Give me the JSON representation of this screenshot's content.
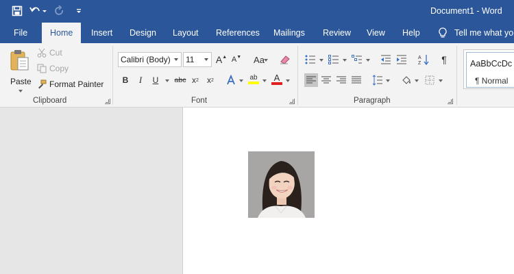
{
  "window": {
    "title": "Document1 - Word"
  },
  "quick_access": {
    "icons": [
      "save-icon",
      "undo-icon",
      "redo-icon",
      "customize-icon"
    ]
  },
  "tabs": [
    {
      "label": "File"
    },
    {
      "label": "Home",
      "active": true
    },
    {
      "label": "Insert"
    },
    {
      "label": "Design"
    },
    {
      "label": "Layout"
    },
    {
      "label": "References"
    },
    {
      "label": "Mailings"
    },
    {
      "label": "Review"
    },
    {
      "label": "View"
    },
    {
      "label": "Help"
    }
  ],
  "tell_me": {
    "label": "Tell me what yo"
  },
  "clipboard": {
    "group_label": "Clipboard",
    "paste_label": "Paste",
    "cut_label": "Cut",
    "copy_label": "Copy",
    "format_painter_label": "Format Painter"
  },
  "font": {
    "group_label": "Font",
    "font_name": "Calibri (Body)",
    "font_size": "11",
    "grow_label": "A",
    "shrink_label": "A",
    "change_case_label": "Aa",
    "bold_label": "B",
    "italic_label": "I",
    "underline_label": "U",
    "strike_label": "abc",
    "subscript_label": "x",
    "superscript_label": "x",
    "highlight_label": "ab",
    "font_color_label": "A",
    "highlight_color": "#ffff00",
    "font_color": "#e02020"
  },
  "paragraph": {
    "group_label": "Paragraph",
    "pilcrow": "¶"
  },
  "styles": {
    "sample": "AaBbCcDc",
    "name": "¶ Normal"
  },
  "colors": {
    "accent": "#2b579a",
    "ribbon_bg": "#f3f3f3",
    "doc_bg": "#e6e6e6"
  }
}
